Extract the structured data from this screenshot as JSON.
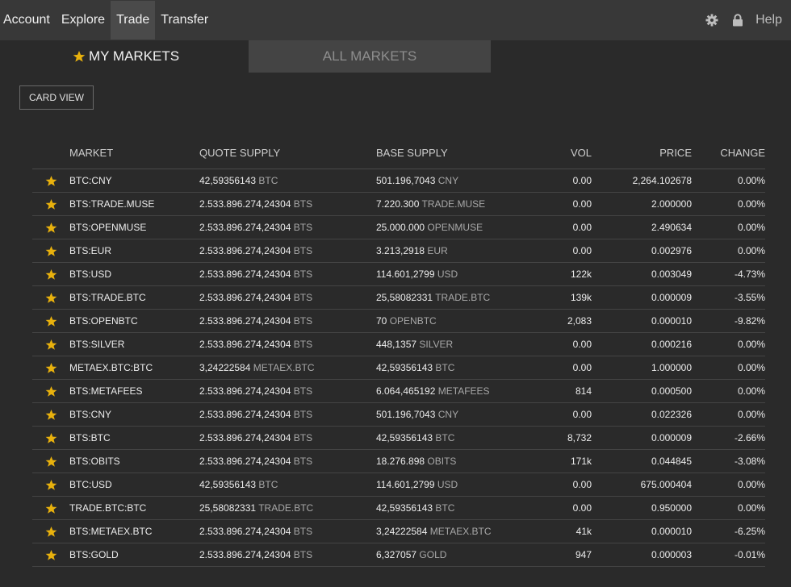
{
  "nav": {
    "items": [
      {
        "label": "Account"
      },
      {
        "label": "Explore"
      },
      {
        "label": "Trade"
      },
      {
        "label": "Transfer"
      }
    ],
    "active_index": 2,
    "help_label": "Help",
    "icons": [
      "gear-icon",
      "lock-icon"
    ]
  },
  "tabs": {
    "my_markets": "MY MARKETS",
    "all_markets": "ALL MARKETS"
  },
  "card_view_label": "CARD VIEW",
  "colors": {
    "accent_star": "#e8b10d",
    "negative": "#e0474c",
    "background": "#2a2a2a",
    "topbar": "#383838"
  },
  "table": {
    "headers": {
      "market": "MARKET",
      "quote_supply": "QUOTE SUPPLY",
      "base_supply": "BASE SUPPLY",
      "vol": "VOL",
      "price": "PRICE",
      "change": "CHANGE"
    },
    "rows": [
      {
        "market": "BTC:CNY",
        "quote_amount": "42,59356143",
        "quote_unit": "BTC",
        "base_amount": "501.196,7043",
        "base_unit": "CNY",
        "vol": "0.00",
        "price": "2,264.102678",
        "change": "0.00%",
        "negative": false
      },
      {
        "market": "BTS:TRADE.MUSE",
        "quote_amount": "2.533.896.274,24304",
        "quote_unit": "BTS",
        "base_amount": "7.220.300",
        "base_unit": "TRADE.MUSE",
        "vol": "0.00",
        "price": "2.000000",
        "change": "0.00%",
        "negative": false
      },
      {
        "market": "BTS:OPENMUSE",
        "quote_amount": "2.533.896.274,24304",
        "quote_unit": "BTS",
        "base_amount": "25.000.000",
        "base_unit": "OPENMUSE",
        "vol": "0.00",
        "price": "2.490634",
        "change": "0.00%",
        "negative": false
      },
      {
        "market": "BTS:EUR",
        "quote_amount": "2.533.896.274,24304",
        "quote_unit": "BTS",
        "base_amount": "3.213,2918",
        "base_unit": "EUR",
        "vol": "0.00",
        "price": "0.002976",
        "change": "0.00%",
        "negative": false
      },
      {
        "market": "BTS:USD",
        "quote_amount": "2.533.896.274,24304",
        "quote_unit": "BTS",
        "base_amount": "114.601,2799",
        "base_unit": "USD",
        "vol": "122k",
        "price": "0.003049",
        "change": "-4.73%",
        "negative": true
      },
      {
        "market": "BTS:TRADE.BTC",
        "quote_amount": "2.533.896.274,24304",
        "quote_unit": "BTS",
        "base_amount": "25,58082331",
        "base_unit": "TRADE.BTC",
        "vol": "139k",
        "price": "0.000009",
        "change": "-3.55%",
        "negative": true
      },
      {
        "market": "BTS:OPENBTC",
        "quote_amount": "2.533.896.274,24304",
        "quote_unit": "BTS",
        "base_amount": "70",
        "base_unit": "OPENBTC",
        "vol": "2,083",
        "price": "0.000010",
        "change": "-9.82%",
        "negative": true
      },
      {
        "market": "BTS:SILVER",
        "quote_amount": "2.533.896.274,24304",
        "quote_unit": "BTS",
        "base_amount": "448,1357",
        "base_unit": "SILVER",
        "vol": "0.00",
        "price": "0.000216",
        "change": "0.00%",
        "negative": false
      },
      {
        "market": "METAEX.BTC:BTC",
        "quote_amount": "3,24222584",
        "quote_unit": "METAEX.BTC",
        "base_amount": "42,59356143",
        "base_unit": "BTC",
        "vol": "0.00",
        "price": "1.000000",
        "change": "0.00%",
        "negative": false
      },
      {
        "market": "BTS:METAFEES",
        "quote_amount": "2.533.896.274,24304",
        "quote_unit": "BTS",
        "base_amount": "6.064,465192",
        "base_unit": "METAFEES",
        "vol": "814",
        "price": "0.000500",
        "change": "0.00%",
        "negative": false
      },
      {
        "market": "BTS:CNY",
        "quote_amount": "2.533.896.274,24304",
        "quote_unit": "BTS",
        "base_amount": "501.196,7043",
        "base_unit": "CNY",
        "vol": "0.00",
        "price": "0.022326",
        "change": "0.00%",
        "negative": false
      },
      {
        "market": "BTS:BTC",
        "quote_amount": "2.533.896.274,24304",
        "quote_unit": "BTS",
        "base_amount": "42,59356143",
        "base_unit": "BTC",
        "vol": "8,732",
        "price": "0.000009",
        "change": "-2.66%",
        "negative": true
      },
      {
        "market": "BTS:OBITS",
        "quote_amount": "2.533.896.274,24304",
        "quote_unit": "BTS",
        "base_amount": "18.276.898",
        "base_unit": "OBITS",
        "vol": "171k",
        "price": "0.044845",
        "change": "-3.08%",
        "negative": true
      },
      {
        "market": "BTC:USD",
        "quote_amount": "42,59356143",
        "quote_unit": "BTC",
        "base_amount": "114.601,2799",
        "base_unit": "USD",
        "vol": "0.00",
        "price": "675.000404",
        "change": "0.00%",
        "negative": false
      },
      {
        "market": "TRADE.BTC:BTC",
        "quote_amount": "25,58082331",
        "quote_unit": "TRADE.BTC",
        "base_amount": "42,59356143",
        "base_unit": "BTC",
        "vol": "0.00",
        "price": "0.950000",
        "change": "0.00%",
        "negative": false
      },
      {
        "market": "BTS:METAEX.BTC",
        "quote_amount": "2.533.896.274,24304",
        "quote_unit": "BTS",
        "base_amount": "3,24222584",
        "base_unit": "METAEX.BTC",
        "vol": "41k",
        "price": "0.000010",
        "change": "-6.25%",
        "negative": true
      },
      {
        "market": "BTS:GOLD",
        "quote_amount": "2.533.896.274,24304",
        "quote_unit": "BTS",
        "base_amount": "6,327057",
        "base_unit": "GOLD",
        "vol": "947",
        "price": "0.000003",
        "change": "-0.01%",
        "negative": true
      }
    ]
  }
}
